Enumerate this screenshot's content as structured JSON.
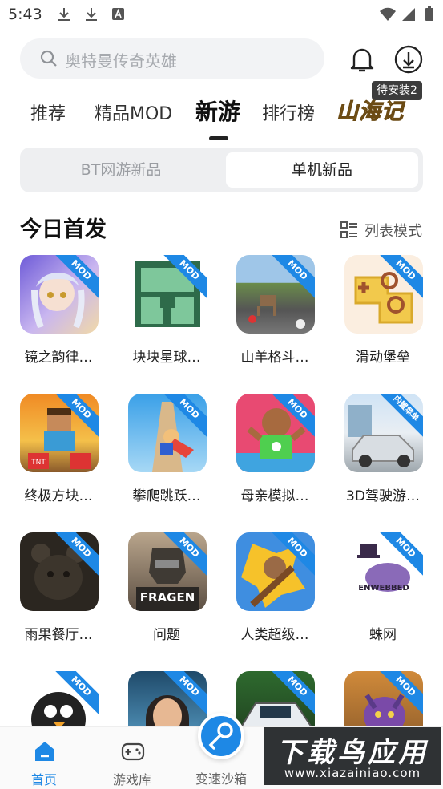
{
  "status_bar": {
    "time": "5:43"
  },
  "search": {
    "placeholder": "奥特曼传奇英雄"
  },
  "header": {
    "install_badge": "待安装2"
  },
  "tabs": [
    {
      "label": "推荐"
    },
    {
      "label": "精品MOD"
    },
    {
      "label": "新游",
      "active": true
    },
    {
      "label": "排行榜"
    }
  ],
  "promo_logo": "山海记",
  "segment": {
    "options": [
      "BT网游新品",
      "单机新品"
    ],
    "selected": "单机新品"
  },
  "section": {
    "title": "今日首发",
    "view_mode_label": "列表模式"
  },
  "ribbon_label": "MOD",
  "ribbon_label_alt": "内置菜单",
  "games": [
    {
      "name": "镜之韵律…",
      "ribbon": "MOD"
    },
    {
      "name": "块块星球…",
      "ribbon": "MOD"
    },
    {
      "name": "山羊格斗…",
      "ribbon": "MOD"
    },
    {
      "name": "滑动堡垒",
      "ribbon": "MOD"
    },
    {
      "name": "终极方块…",
      "ribbon": "MOD"
    },
    {
      "name": "攀爬跳跃…",
      "ribbon": "MOD"
    },
    {
      "name": "母亲模拟…",
      "ribbon": "MOD"
    },
    {
      "name": "3D驾驶游…",
      "ribbon": "内置菜单"
    },
    {
      "name": "雨果餐厅…",
      "ribbon": "MOD"
    },
    {
      "name": "问题",
      "ribbon": "MOD"
    },
    {
      "name": "人类超级…",
      "ribbon": "MOD"
    },
    {
      "name": "蛛网",
      "ribbon": "MOD"
    },
    {
      "name": "",
      "ribbon": "MOD"
    },
    {
      "name": "",
      "ribbon": "MOD"
    },
    {
      "name": "",
      "ribbon": "MOD"
    },
    {
      "name": "",
      "ribbon": "MOD"
    }
  ],
  "icon_texts": {
    "fragen": "FRAGEN",
    "enwebbed": "ENWEBBED",
    "tnt": "TNT"
  },
  "bottom_nav": [
    {
      "label": "首页",
      "active": true
    },
    {
      "label": "游戏库"
    },
    {
      "label": "变速沙箱"
    }
  ],
  "watermark": {
    "title": "下载鸟应用",
    "url": "www.xiazainiao.com"
  },
  "colors": {
    "accent": "#1e88e5",
    "badge_bg": "#3c3c3c",
    "search_bg": "#f2f3f5"
  }
}
